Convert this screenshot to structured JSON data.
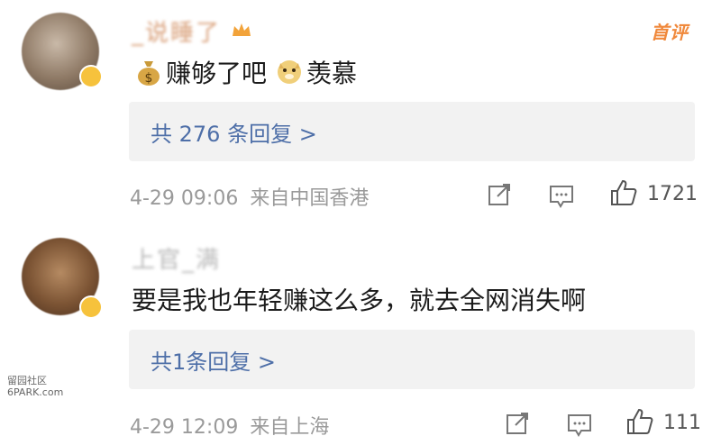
{
  "comments": [
    {
      "username": "_说睡了",
      "badge": "首评",
      "text": "赚够了吧",
      "text2": "羡慕",
      "emojis": [
        "money-bag-icon",
        "dog-doge-icon"
      ],
      "reply_link": "共 276 条回复 >",
      "timestamp": "4-29 09:06",
      "location": "来自中国香港",
      "likes": "1721"
    },
    {
      "username": "上官_满",
      "text": "要是我也年轻赚这么多，就去全网消失啊",
      "reply_link": "共1条回复 >",
      "timestamp": "4-29 12:09",
      "location": "来自上海",
      "likes": "111"
    }
  ],
  "watermark": {
    "line1": "留园社区",
    "line2": "6PARK.com"
  },
  "colors": {
    "reply_link": "#4e6fa8",
    "meta": "#9a9a9a",
    "badge": "#f0893c",
    "reply_bg": "#f2f2f2"
  }
}
